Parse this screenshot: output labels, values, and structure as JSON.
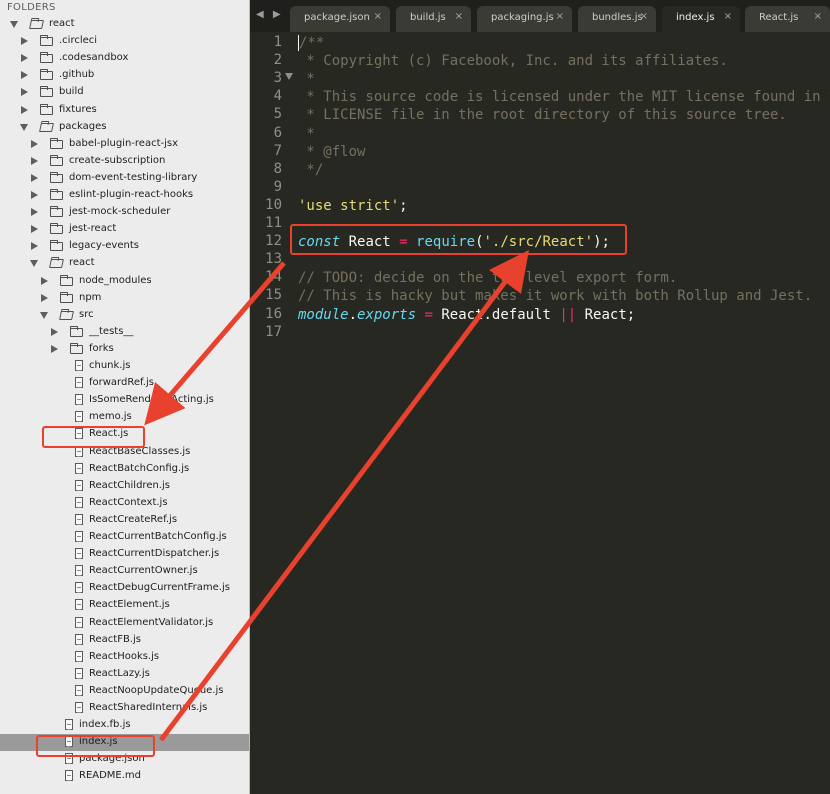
{
  "sidebar": {
    "header": "FOLDERS",
    "tree": [
      {
        "label": "react",
        "type": "folder",
        "expanded": true,
        "depth": 0
      },
      {
        "label": ".circleci",
        "type": "folder",
        "expanded": false,
        "depth": 1
      },
      {
        "label": ".codesandbox",
        "type": "folder",
        "expanded": false,
        "depth": 1
      },
      {
        "label": ".github",
        "type": "folder",
        "expanded": false,
        "depth": 1
      },
      {
        "label": "build",
        "type": "folder",
        "expanded": false,
        "depth": 1
      },
      {
        "label": "fixtures",
        "type": "folder",
        "expanded": false,
        "depth": 1
      },
      {
        "label": "packages",
        "type": "folder",
        "expanded": true,
        "depth": 1
      },
      {
        "label": "babel-plugin-react-jsx",
        "type": "folder",
        "expanded": false,
        "depth": 2
      },
      {
        "label": "create-subscription",
        "type": "folder",
        "expanded": false,
        "depth": 2
      },
      {
        "label": "dom-event-testing-library",
        "type": "folder",
        "expanded": false,
        "depth": 2
      },
      {
        "label": "eslint-plugin-react-hooks",
        "type": "folder",
        "expanded": false,
        "depth": 2
      },
      {
        "label": "jest-mock-scheduler",
        "type": "folder",
        "expanded": false,
        "depth": 2
      },
      {
        "label": "jest-react",
        "type": "folder",
        "expanded": false,
        "depth": 2
      },
      {
        "label": "legacy-events",
        "type": "folder",
        "expanded": false,
        "depth": 2
      },
      {
        "label": "react",
        "type": "folder",
        "expanded": true,
        "depth": 2
      },
      {
        "label": "node_modules",
        "type": "folder",
        "expanded": false,
        "depth": 3
      },
      {
        "label": "npm",
        "type": "folder",
        "expanded": false,
        "depth": 3
      },
      {
        "label": "src",
        "type": "folder",
        "expanded": true,
        "depth": 3
      },
      {
        "label": "__tests__",
        "type": "folder",
        "expanded": false,
        "depth": 4
      },
      {
        "label": "forks",
        "type": "folder",
        "expanded": false,
        "depth": 4
      },
      {
        "label": "chunk.js",
        "type": "file",
        "depth": 4
      },
      {
        "label": "forwardRef.js",
        "type": "file",
        "depth": 4
      },
      {
        "label": "IsSomeRendererActing.js",
        "type": "file",
        "depth": 4
      },
      {
        "label": "memo.js",
        "type": "file",
        "depth": 4
      },
      {
        "label": "React.js",
        "type": "file",
        "depth": 4,
        "highlighted": true
      },
      {
        "label": "ReactBaseClasses.js",
        "type": "file",
        "depth": 4
      },
      {
        "label": "ReactBatchConfig.js",
        "type": "file",
        "depth": 4
      },
      {
        "label": "ReactChildren.js",
        "type": "file",
        "depth": 4
      },
      {
        "label": "ReactContext.js",
        "type": "file",
        "depth": 4
      },
      {
        "label": "ReactCreateRef.js",
        "type": "file",
        "depth": 4
      },
      {
        "label": "ReactCurrentBatchConfig.js",
        "type": "file",
        "depth": 4
      },
      {
        "label": "ReactCurrentDispatcher.js",
        "type": "file",
        "depth": 4
      },
      {
        "label": "ReactCurrentOwner.js",
        "type": "file",
        "depth": 4
      },
      {
        "label": "ReactDebugCurrentFrame.js",
        "type": "file",
        "depth": 4
      },
      {
        "label": "ReactElement.js",
        "type": "file",
        "depth": 4
      },
      {
        "label": "ReactElementValidator.js",
        "type": "file",
        "depth": 4
      },
      {
        "label": "ReactFB.js",
        "type": "file",
        "depth": 4
      },
      {
        "label": "ReactHooks.js",
        "type": "file",
        "depth": 4
      },
      {
        "label": "ReactLazy.js",
        "type": "file",
        "depth": 4
      },
      {
        "label": "ReactNoopUpdateQueue.js",
        "type": "file",
        "depth": 4
      },
      {
        "label": "ReactSharedInternals.js",
        "type": "file",
        "depth": 4
      },
      {
        "label": "index.fb.js",
        "type": "file",
        "depth": 3
      },
      {
        "label": "index.js",
        "type": "file",
        "depth": 3,
        "selected": true,
        "highlighted": true
      },
      {
        "label": "package.json",
        "type": "file",
        "depth": 3
      },
      {
        "label": "README.md",
        "type": "file",
        "depth": 3
      }
    ]
  },
  "tabs": [
    {
      "label": "package.json",
      "active": false
    },
    {
      "label": "build.js",
      "active": false
    },
    {
      "label": "packaging.js",
      "active": false
    },
    {
      "label": "bundles.js",
      "active": false
    },
    {
      "label": "index.js",
      "active": true
    },
    {
      "label": "React.js",
      "active": false
    }
  ],
  "tab_close_glyph": "×",
  "nav_arrows": "◀ ▶",
  "code_lines": [
    [
      {
        "t": "/**",
        "c": "cm"
      }
    ],
    [
      {
        "t": " * Copyright (c) Facebook, Inc. and its affiliates.",
        "c": "cm"
      }
    ],
    [
      {
        "t": " *",
        "c": "cm"
      }
    ],
    [
      {
        "t": " * This source code is licensed under the MIT license found in the",
        "c": "cm"
      }
    ],
    [
      {
        "t": " * LICENSE file in the root directory of this source tree.",
        "c": "cm"
      }
    ],
    [
      {
        "t": " *",
        "c": "cm"
      }
    ],
    [
      {
        "t": " * @flow",
        "c": "cm"
      }
    ],
    [
      {
        "t": " */",
        "c": "cm"
      }
    ],
    [],
    [
      {
        "t": "'use strict'",
        "c": "str"
      },
      {
        "t": ";",
        "c": "pl"
      }
    ],
    [],
    [
      {
        "t": "const",
        "c": "kw"
      },
      {
        "t": " React ",
        "c": "pl"
      },
      {
        "t": "=",
        "c": "op"
      },
      {
        "t": " ",
        "c": "pl"
      },
      {
        "t": "require",
        "c": "fn"
      },
      {
        "t": "(",
        "c": "pl"
      },
      {
        "t": "'./src/React'",
        "c": "str"
      },
      {
        "t": ");",
        "c": "pl"
      }
    ],
    [],
    [
      {
        "t": "// TODO: decide on the top-level export form.",
        "c": "cm"
      }
    ],
    [
      {
        "t": "// This is hacky but makes it work with both Rollup and Jest.",
        "c": "cm"
      }
    ],
    [
      {
        "t": "module",
        "c": "kw"
      },
      {
        "t": ".",
        "c": "pl"
      },
      {
        "t": "exports",
        "c": "kw"
      },
      {
        "t": " ",
        "c": "pl"
      },
      {
        "t": "=",
        "c": "op"
      },
      {
        "t": " React.default ",
        "c": "pl"
      },
      {
        "t": "||",
        "c": "op"
      },
      {
        "t": " React;",
        "c": "pl"
      }
    ],
    []
  ],
  "colors": {
    "annotation": "#e8412e",
    "editor_bg": "#272822",
    "sidebar_bg": "#ececec"
  }
}
